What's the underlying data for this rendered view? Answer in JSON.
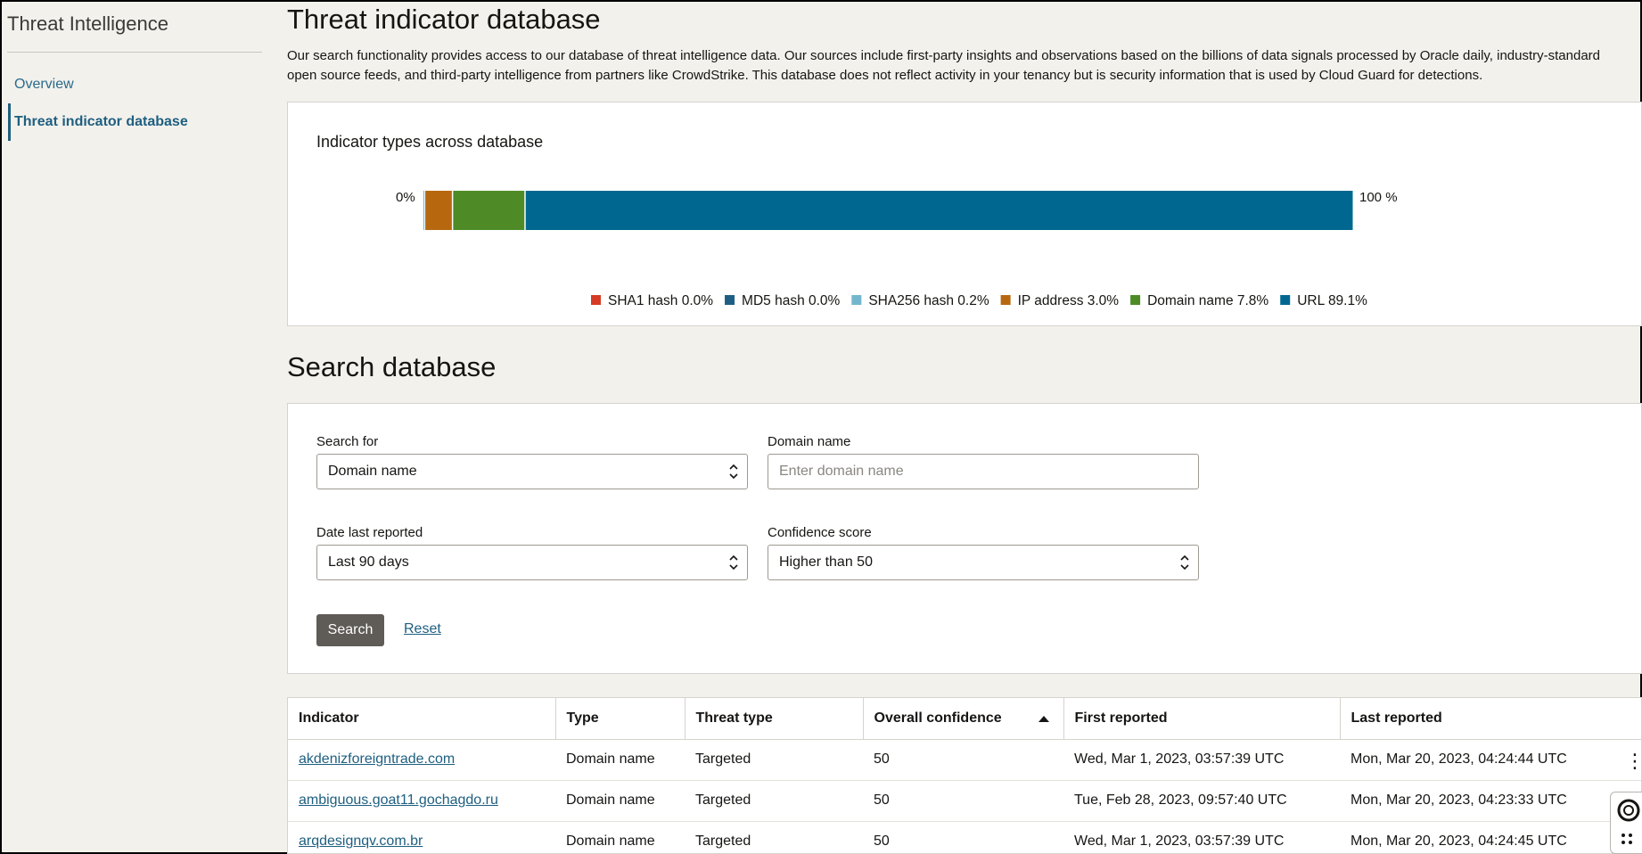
{
  "sidebar": {
    "title": "Threat Intelligence",
    "items": [
      {
        "label": "Overview"
      },
      {
        "label": "Threat indicator database"
      }
    ]
  },
  "page": {
    "title": "Threat indicator database",
    "description": "Our search functionality provides access to our database of threat intelligence data. Our sources include first-party insights and observations based on the billions of data signals processed by Oracle daily, industry-standard open source feeds, and third-party intelligence from partners like CrowdStrike. This database does not reflect activity in your tenancy but is security information that is used by Cloud Guard for detections."
  },
  "chart_data": {
    "type": "bar",
    "orientation": "horizontal-stacked-100",
    "title": "Indicator types across database",
    "axis_min_label": "0%",
    "axis_max_label": "100 %",
    "legend_placement": "bottom",
    "series": [
      {
        "name": "SHA1 hash",
        "value": 0.0,
        "label": "SHA1 hash 0.0%",
        "color": "#d63b25"
      },
      {
        "name": "MD5 hash",
        "value": 0.0,
        "label": "MD5 hash 0.0%",
        "color": "#1f5e83"
      },
      {
        "name": "SHA256 hash",
        "value": 0.2,
        "label": "SHA256 hash 0.2%",
        "color": "#74b7cc"
      },
      {
        "name": "IP address",
        "value": 3.0,
        "label": "IP address 3.0%",
        "color": "#b7680f"
      },
      {
        "name": "Domain name",
        "value": 7.8,
        "label": "Domain name 7.8%",
        "color": "#4e8b26"
      },
      {
        "name": "URL",
        "value": 89.1,
        "label": "URL 89.1%",
        "color": "#006890"
      }
    ]
  },
  "search": {
    "heading": "Search database",
    "search_for_label": "Search for",
    "search_for_value": "Domain name",
    "domain_label": "Domain name",
    "domain_placeholder": "Enter domain name",
    "date_label": "Date last reported",
    "date_value": "Last 90 days",
    "confidence_label": "Confidence score",
    "confidence_value": "Higher than 50",
    "search_button": "Search",
    "reset_link": "Reset"
  },
  "table": {
    "columns": [
      "Indicator",
      "Type",
      "Threat type",
      "Overall confidence",
      "First reported",
      "Last reported"
    ],
    "rows": [
      [
        "akdenizforeigntrade.com",
        "Domain name",
        "Targeted",
        "50",
        "Wed, Mar 1, 2023, 03:57:39 UTC",
        "Mon, Mar 20, 2023, 04:24:44 UTC"
      ],
      [
        "ambiguous.goat11.gochagdo.ru",
        "Domain name",
        "Targeted",
        "50",
        "Tue, Feb 28, 2023, 09:57:40 UTC",
        "Mon, Mar 20, 2023, 04:23:33 UTC"
      ],
      [
        "arqdesignqv.com.br",
        "Domain name",
        "Targeted",
        "50",
        "Wed, Mar 1, 2023, 03:57:39 UTC",
        "Mon, Mar 20, 2023, 04:24:45 UTC"
      ]
    ],
    "row_actions_icon": "kebab-menu-icon"
  },
  "help_widget_icon": "help-lifebuoy-icon"
}
